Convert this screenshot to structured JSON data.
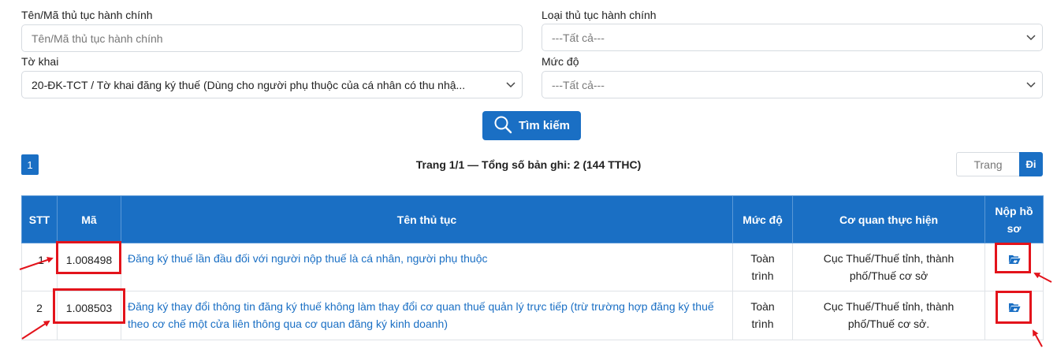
{
  "filters": {
    "name": {
      "label": "Tên/Mã thủ tục hành chính",
      "placeholder": "Tên/Mã thủ tục hành chính"
    },
    "type": {
      "label": "Loại thủ tục hành chính",
      "value": "---Tất cả---"
    },
    "form": {
      "label": "Tờ khai",
      "value": "20-ĐK-TCT / Tờ khai đăng ký thuế (Dùng cho người phụ thuộc của cá nhân có thu nhậ..."
    },
    "level": {
      "label": "Mức độ",
      "value": "---Tất cả---"
    }
  },
  "search_button": {
    "label": "Tìm kiếm",
    "icon": "search-icon"
  },
  "pagination": {
    "current_page": "1",
    "info": "Trang 1/1 — Tổng số bản ghi: 2 (144 TTHC)",
    "page_input_placeholder": "Trang",
    "go_label": "Đi"
  },
  "table": {
    "headers": {
      "stt": "STT",
      "ma": "Mã",
      "ten": "Tên thủ tục",
      "muc_do": "Mức độ",
      "co_quan": "Cơ quan thực hiện",
      "nop_ho_so": "Nộp hồ sơ"
    },
    "rows": [
      {
        "stt": "1",
        "ma": "1.008498",
        "ten": "Đăng ký thuế lần đầu đối với người nộp thuế là cá nhân, người phụ thuộc",
        "muc_do": "Toàn trình",
        "co_quan": "Cục Thuế/Thuế tỉnh, thành phố/Thuế cơ sở",
        "icon": "folder-open-icon"
      },
      {
        "stt": "2",
        "ma": "1.008503",
        "ten": "Đăng ký thay đổi thông tin đăng ký thuế không làm thay đổi cơ quan thuế quản lý trực tiếp (trừ trường hợp đăng ký thuế theo cơ chế một cửa liên thông qua cơ quan đăng ký kinh doanh)",
        "muc_do": "Toàn trình",
        "co_quan": "Cục Thuế/Thuế tỉnh, thành phố/Thuế cơ sở.",
        "icon": "folder-open-icon"
      }
    ]
  },
  "colors": {
    "primary": "#1a6fc4",
    "annotation": "#e3131b",
    "link": "#1a6fc4"
  }
}
